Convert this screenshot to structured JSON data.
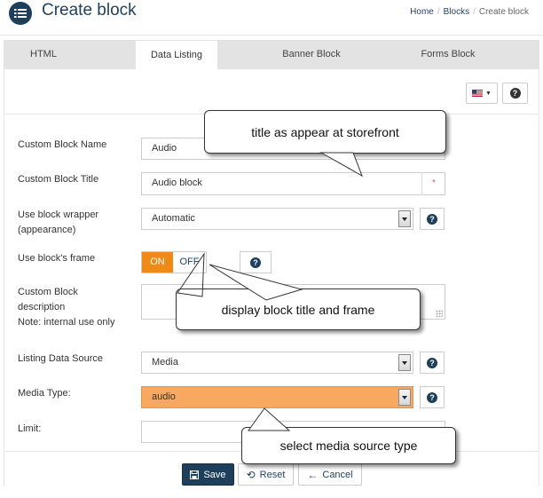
{
  "header": {
    "title": "Create block",
    "breadcrumb": [
      "Home",
      "Blocks",
      "Create block"
    ]
  },
  "tabs": [
    {
      "label": "HTML",
      "active": false
    },
    {
      "label": "Data Listing",
      "active": true
    },
    {
      "label": "Banner Block",
      "active": false
    },
    {
      "label": "Forms Block",
      "active": false
    }
  ],
  "toolbar": {
    "language_icon": "us-flag-icon",
    "help_icon": "question-icon"
  },
  "form": {
    "name_label": "Custom Block Name",
    "name_value": "Audio",
    "title_label": "Custom Block Title",
    "title_value": "Audio block",
    "title_required": "*",
    "wrapper_label_1": "Use block wrapper",
    "wrapper_label_2": "(appearance)",
    "wrapper_value": "Automatic",
    "frame_label": "Use block's frame",
    "frame_on": "ON",
    "frame_off": "OFF",
    "desc_label_1": "Custom Block",
    "desc_label_2": "description",
    "desc_label_3": "Note: internal use only",
    "source_label": "Listing Data Source",
    "source_value": "Media",
    "media_label": "Media Type:",
    "media_value": "audio",
    "limit_label": "Limit:",
    "limit_value": ""
  },
  "buttons": {
    "save": "Save",
    "reset": "Reset",
    "cancel": "Cancel"
  },
  "callouts": {
    "title": "title as appear at storefront",
    "frame": "display block title and frame",
    "media": "select media source type"
  },
  "colors": {
    "brand": "#1e3f5c",
    "toggle_on": "#ef8a17",
    "highlight": "#f9a85f"
  }
}
